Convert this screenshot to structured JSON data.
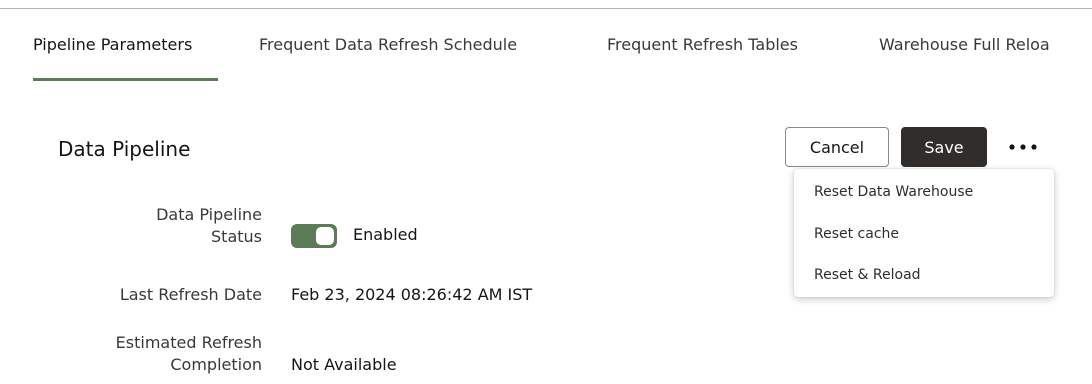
{
  "tabs": [
    {
      "label": "Pipeline Parameters",
      "active": true
    },
    {
      "label": "Frequent Data Refresh Schedule",
      "active": false
    },
    {
      "label": "Frequent Refresh Tables",
      "active": false
    },
    {
      "label": "Warehouse Full Reloa",
      "active": false
    }
  ],
  "page_title": "Data Pipeline",
  "actions": {
    "cancel_label": "Cancel",
    "save_label": "Save",
    "more_icon": "more-horizontal-icon"
  },
  "more_menu": {
    "items": [
      {
        "label": "Reset Data Warehouse"
      },
      {
        "label": "Reset cache"
      },
      {
        "label": "Reset & Reload"
      }
    ]
  },
  "fields": {
    "status": {
      "label_line1": "Data Pipeline",
      "label_line2": "Status",
      "toggle_on": true,
      "value": "Enabled"
    },
    "last_refresh": {
      "label": "Last Refresh Date",
      "value": "Feb 23, 2024 08:26:42 AM IST"
    },
    "estimated_completion": {
      "label_line1": "Estimated Refresh",
      "label_line2": "Completion",
      "value": "Not Available"
    }
  },
  "colors": {
    "accent": "#5b7c56",
    "primary_button": "#312d2a",
    "text": "#161513"
  }
}
